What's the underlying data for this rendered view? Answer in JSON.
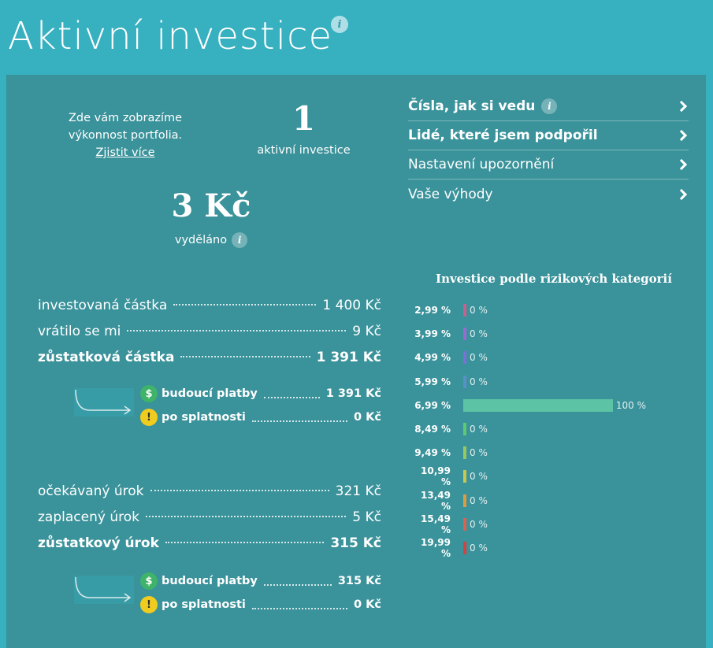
{
  "page": {
    "title": "Aktivní investice"
  },
  "summary": {
    "text_line1": "Zde vám zobrazíme",
    "text_line2": "výkonnost portfolia.",
    "link_label": "Zjistit více",
    "active_count": "1",
    "active_label": "aktivní investice",
    "earned_value": "3 Kč",
    "earned_label": "vyděláno"
  },
  "menu": {
    "items": [
      {
        "label": "Čísla, jak si vedu",
        "bold": true,
        "info": true
      },
      {
        "label": "Lidé, které jsem podpořil",
        "bold": true,
        "info": false
      },
      {
        "label": "Nastavení upozornění",
        "bold": false,
        "info": false
      },
      {
        "label": "Vaše výhody",
        "bold": false,
        "info": false
      }
    ]
  },
  "principal": {
    "rows": [
      {
        "label": "investovaná částka",
        "value": "1 400 Kč"
      },
      {
        "label": "vrátilo se mi",
        "value": "9 Kč"
      },
      {
        "label": "zůstatková částka",
        "value": "1 391 Kč"
      }
    ],
    "sub": [
      {
        "label": "budoucí platby",
        "value": "1 391 Kč",
        "icon": "dollar-icon"
      },
      {
        "label": "po splatnosti",
        "value": "0 Kč",
        "icon": "warning-icon"
      }
    ]
  },
  "interest": {
    "rows": [
      {
        "label": "očekávaný úrok",
        "value": "321 Kč"
      },
      {
        "label": "zaplacený úrok",
        "value": "5 Kč"
      },
      {
        "label": "zůstatkový úrok",
        "value": "315 Kč"
      }
    ],
    "sub": [
      {
        "label": "budoucí platby",
        "value": "315 Kč",
        "icon": "dollar-icon"
      },
      {
        "label": "po splatnosti",
        "value": "0 Kč",
        "icon": "warning-icon"
      }
    ]
  },
  "icons": {
    "dollar": "$",
    "warning": "!",
    "info": "i"
  },
  "chart_data": {
    "type": "bar",
    "title": "Investice podle rizikových kategorií",
    "categories": [
      "2,99 %",
      "3,99 %",
      "4,99 %",
      "5,99 %",
      "6,99 %",
      "8,49 %",
      "9,49 %",
      "10,99 %",
      "13,49 %",
      "15,49 %",
      "19,99 %"
    ],
    "values": [
      0,
      0,
      0,
      0,
      100,
      0,
      0,
      0,
      0,
      0,
      0
    ],
    "value_labels": [
      "0 %",
      "0 %",
      "0 %",
      "0 %",
      "100 %",
      "0 %",
      "0 %",
      "0 %",
      "0 %",
      "0 %",
      "0 %"
    ],
    "colors": [
      "#c86090",
      "#9a6ad0",
      "#7a70d8",
      "#5a90c8",
      "#5cc4a4",
      "#60c870",
      "#98c860",
      "#c8c850",
      "#e09a40",
      "#e06050",
      "#d84040"
    ],
    "xlim": [
      0,
      100
    ]
  }
}
